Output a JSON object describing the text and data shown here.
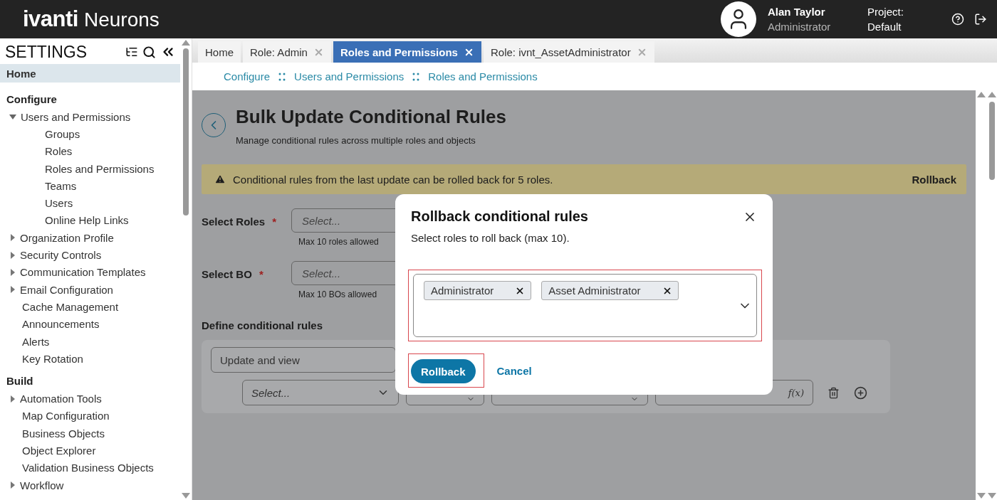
{
  "header": {
    "logo_word": "ivanti",
    "product": "Neurons",
    "user_name": "Alan Taylor",
    "user_role": "Administrator",
    "project_label": "Project:",
    "project_value": "Default"
  },
  "sidebar": {
    "title": "SETTINGS",
    "items": [
      {
        "label": "Home",
        "kind": "link",
        "selected": true
      },
      {
        "label": "Configure",
        "kind": "heading",
        "selected": false
      },
      {
        "label": "Users and Permissions",
        "kind": "folder",
        "expanded": true,
        "selected": false,
        "children": [
          {
            "label": "Groups",
            "kind": "leaf",
            "selected": false
          },
          {
            "label": "Roles",
            "kind": "leaf",
            "selected": false
          },
          {
            "label": "Roles and Permissions",
            "kind": "leaf",
            "selected": false
          },
          {
            "label": "Teams",
            "kind": "leaf",
            "selected": false
          },
          {
            "label": "Users",
            "kind": "leaf",
            "selected": false
          },
          {
            "label": "Online Help Links",
            "kind": "leaf",
            "selected": false
          }
        ]
      },
      {
        "label": "Organization Profile",
        "kind": "folder",
        "expanded": false,
        "selected": false
      },
      {
        "label": "Security Controls",
        "kind": "folder",
        "expanded": false,
        "selected": false
      },
      {
        "label": "Communication Templates",
        "kind": "folder",
        "expanded": false,
        "selected": false
      },
      {
        "label": "Email Configuration",
        "kind": "folder",
        "expanded": false,
        "selected": false
      },
      {
        "label": "Cache Management",
        "kind": "leaf",
        "selected": false
      },
      {
        "label": "Announcements",
        "kind": "leaf",
        "selected": false
      },
      {
        "label": "Alerts",
        "kind": "leaf",
        "selected": false
      },
      {
        "label": "Key Rotation",
        "kind": "leaf",
        "selected": false
      },
      {
        "label": "Build",
        "kind": "heading",
        "selected": false
      },
      {
        "label": "Automation Tools",
        "kind": "folder",
        "expanded": false,
        "selected": false
      },
      {
        "label": "Map Configuration",
        "kind": "leaf",
        "selected": false
      },
      {
        "label": "Business Objects",
        "kind": "leaf",
        "selected": false
      },
      {
        "label": "Object Explorer",
        "kind": "leaf",
        "selected": false
      },
      {
        "label": "Validation Business Objects",
        "kind": "leaf",
        "selected": false
      },
      {
        "label": "Workflow",
        "kind": "folder",
        "expanded": false,
        "selected": false
      }
    ]
  },
  "tabs": [
    {
      "label": "Home",
      "closable": false,
      "selected": false
    },
    {
      "label": "Role: Admin",
      "closable": true,
      "selected": false
    },
    {
      "label": "Roles and Permissions",
      "closable": true,
      "selected": true
    },
    {
      "label": "Role: ivnt_AssetAdministrator",
      "closable": true,
      "selected": false
    }
  ],
  "breadcrumb": [
    "Configure",
    "Users and Permissions",
    "Roles and Permissions"
  ],
  "page": {
    "title": "Bulk Update Conditional Rules",
    "subtitle": "Manage conditional rules across multiple roles and objects",
    "alert": {
      "text": "Conditional rules from the last update can be rolled back for 5 roles.",
      "action": "Rollback"
    },
    "fields": [
      {
        "label": "Select Roles",
        "required_mark": "*",
        "placeholder": "Select...",
        "hint": "Max 10 roles allowed"
      },
      {
        "label": "Select BO",
        "required_mark": "*",
        "placeholder": "Select...",
        "hint": "Max 10 BOs allowed"
      }
    ],
    "rules_heading": "Define conditional rules",
    "rule": {
      "action_value": "Update and view",
      "field_placeholder": "Select...",
      "function_label": "f(x)"
    }
  },
  "modal": {
    "title": "Rollback conditional rules",
    "subtitle": "Select roles to roll back (max 10).",
    "chips": [
      "Administrator",
      "Asset Administrator"
    ],
    "primary_button": "Rollback",
    "secondary_button": "Cancel"
  }
}
